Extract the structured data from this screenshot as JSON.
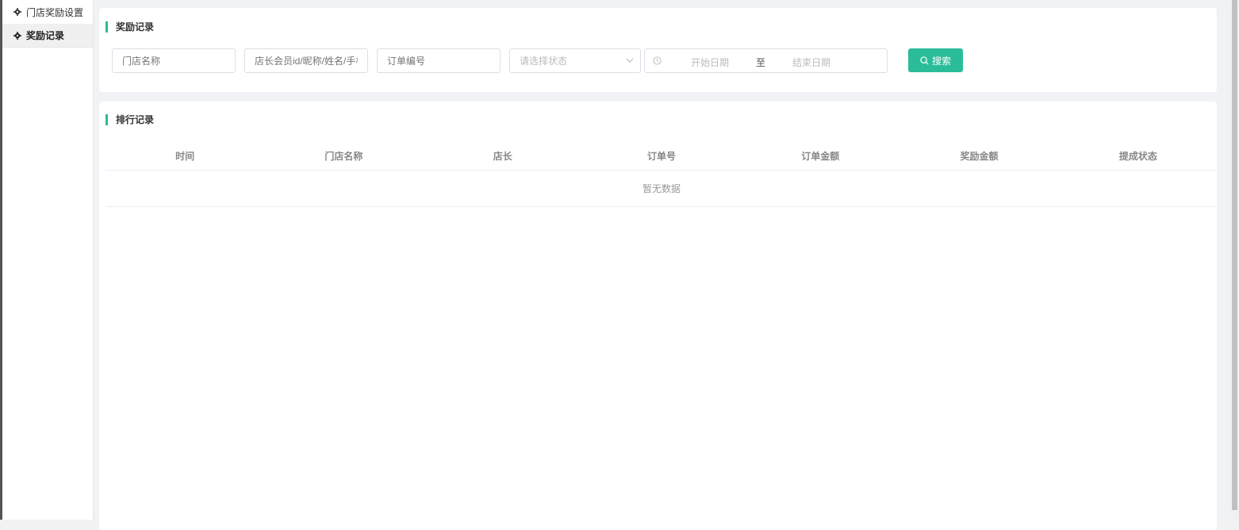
{
  "sidebar": {
    "items": [
      {
        "label": "门店奖励设置",
        "icon": "gear-icon",
        "active": false
      },
      {
        "label": "奖励记录",
        "icon": "gear-icon",
        "active": true
      }
    ]
  },
  "filter_section": {
    "title": "奖励记录",
    "store_name_placeholder": "门店名称",
    "manager_placeholder": "店长会员id/昵称/姓名/手机号",
    "order_no_placeholder": "订单编号",
    "status_placeholder": "请选择状态",
    "date_start_placeholder": "开始日期",
    "date_separator": "至",
    "date_end_placeholder": "结束日期",
    "search_label": "搜索"
  },
  "records_section": {
    "title": "排行记录",
    "columns": [
      "时间",
      "门店名称",
      "店长",
      "订单号",
      "订单金额",
      "奖励金额",
      "提成状态"
    ],
    "empty_text": "暂无数据"
  },
  "colors": {
    "accent": "#2bbd9a",
    "border": "#dcdfe6"
  }
}
